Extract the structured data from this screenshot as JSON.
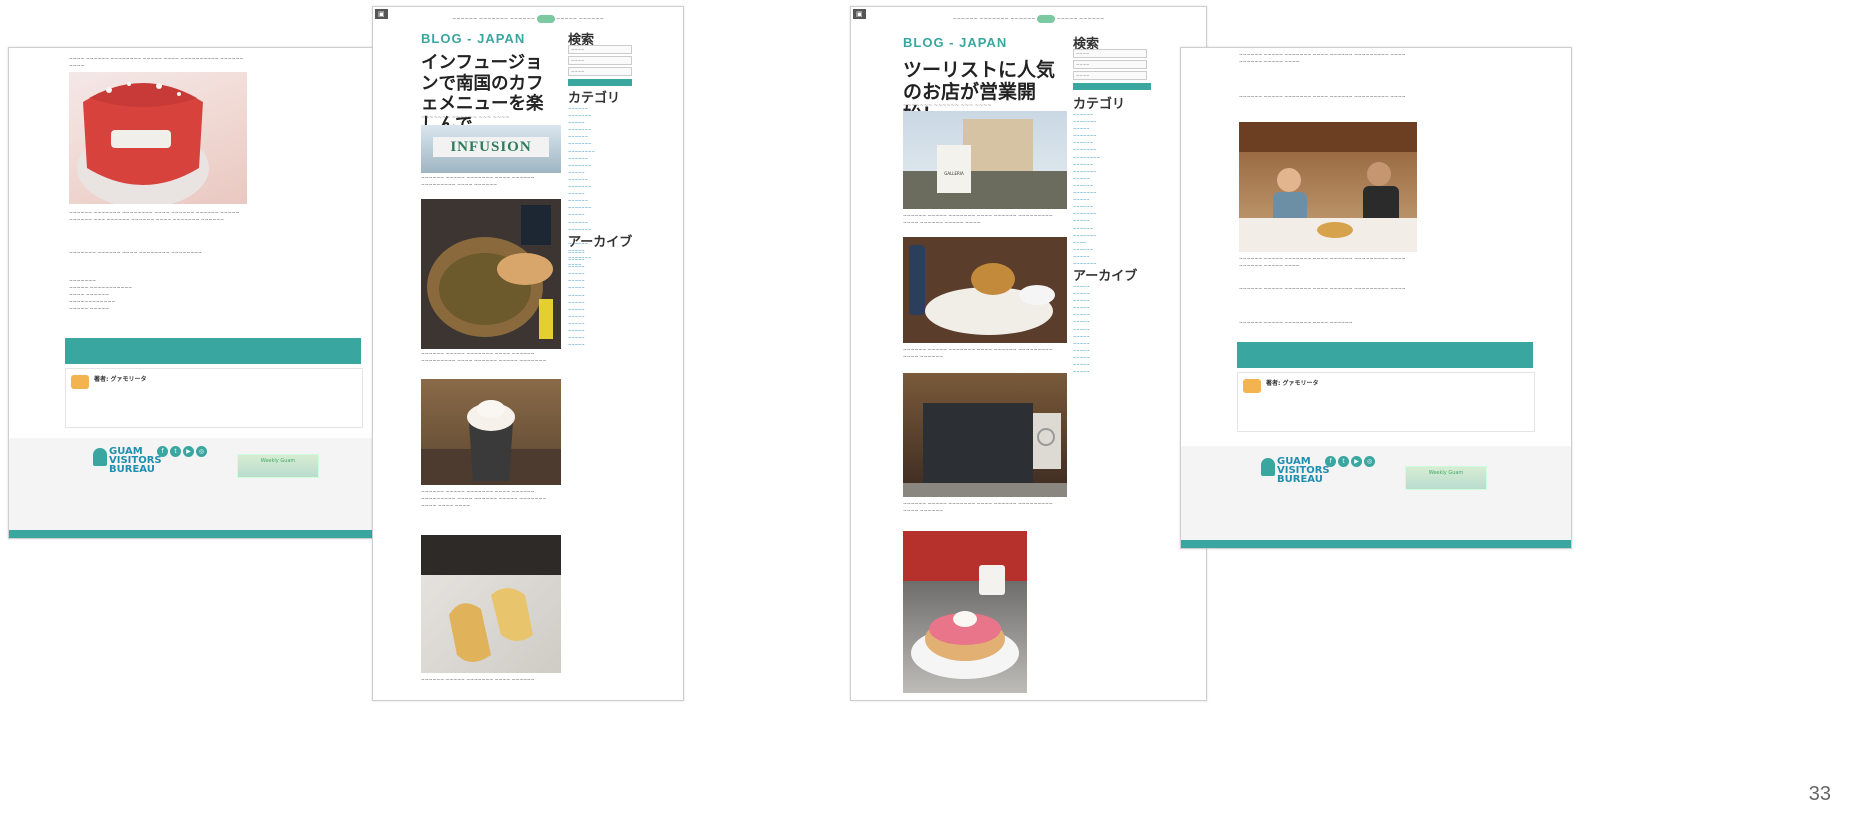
{
  "blog_label": "BLOG - JAPAN",
  "sidebar": {
    "search_heading": "検索",
    "category_heading": "カテゴリ",
    "archive_heading": "アーカイブ"
  },
  "posts": [
    {
      "id": "left",
      "title": "インフュージョンで南国のカフェメニューを楽しんで",
      "photo_banner_text": "INFUSION"
    },
    {
      "id": "right",
      "title": "ツーリストに人気のお店が営業開始！",
      "photo_sign_text": "GALLERIA"
    }
  ],
  "author": {
    "label": "著者: グァモリータ"
  },
  "footer": {
    "logo": "GUAM VISITORS BUREAU",
    "weekly": "Weekly Guam"
  },
  "page_number": "33",
  "colors": {
    "accent": "#3aa6a0",
    "link": "#2a8fb9"
  }
}
